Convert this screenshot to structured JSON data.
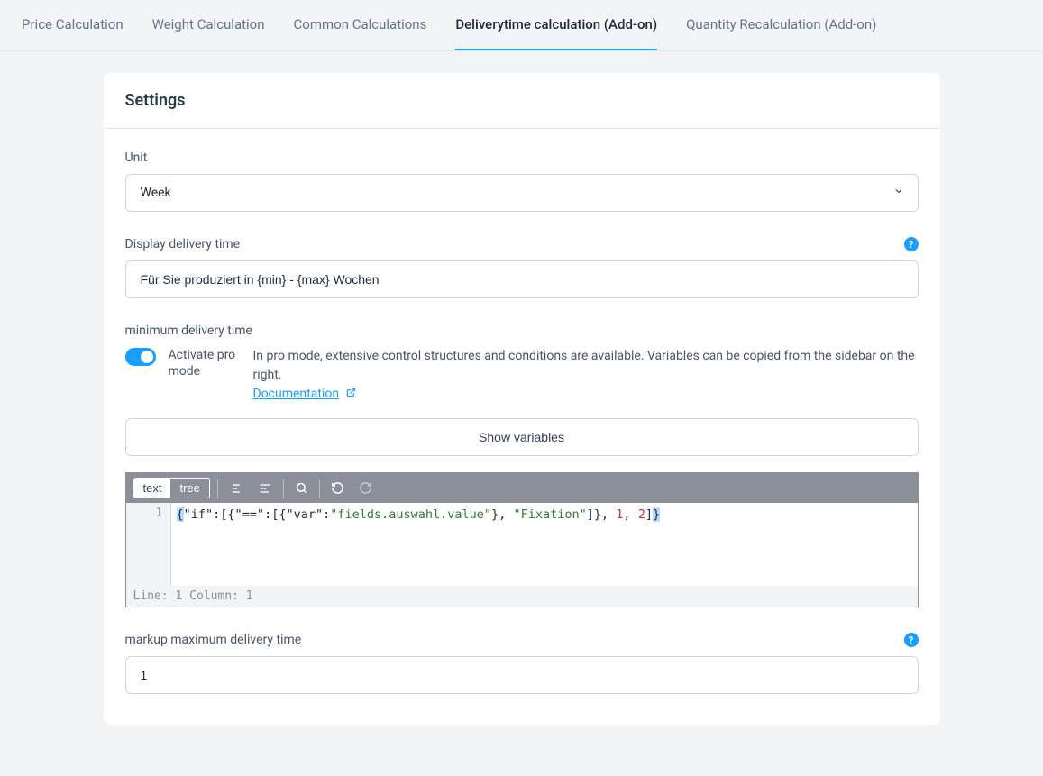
{
  "tabs": [
    {
      "label": "Price Calculation",
      "active": false
    },
    {
      "label": "Weight Calculation",
      "active": false
    },
    {
      "label": "Common Calculations",
      "active": false
    },
    {
      "label": "Deliverytime calculation (Add-on)",
      "active": true
    },
    {
      "label": "Quantity Recalculation (Add-on)",
      "active": false
    }
  ],
  "card": {
    "title": "Settings"
  },
  "unit": {
    "label": "Unit",
    "value": "Week"
  },
  "displayDelivery": {
    "label": "Display delivery time",
    "value": "Für Sie produziert in {min} - {max} Wochen"
  },
  "minDelivery": {
    "label": "minimum delivery time",
    "toggleLabel": "Activate pro mode",
    "proDesc": "In pro mode, extensive control structures and conditions are available. Variables can be copied from the sidebar on the right.",
    "docLink": "Documentation",
    "showVariables": "Show variables"
  },
  "editor": {
    "modeText": "text",
    "modeTree": "tree",
    "lineNumber": "1",
    "tokens": {
      "ifKey": "\"if\"",
      "eqKey": "\"==\"",
      "varKey": "\"var\"",
      "varVal": "\"fields.auswahl.value\"",
      "fixation": "\"Fixation\"",
      "one": "1",
      "two": "2"
    },
    "statusBar": "Line: 1  Column: 1"
  },
  "markupMax": {
    "label": "markup maximum delivery time",
    "value": "1"
  }
}
